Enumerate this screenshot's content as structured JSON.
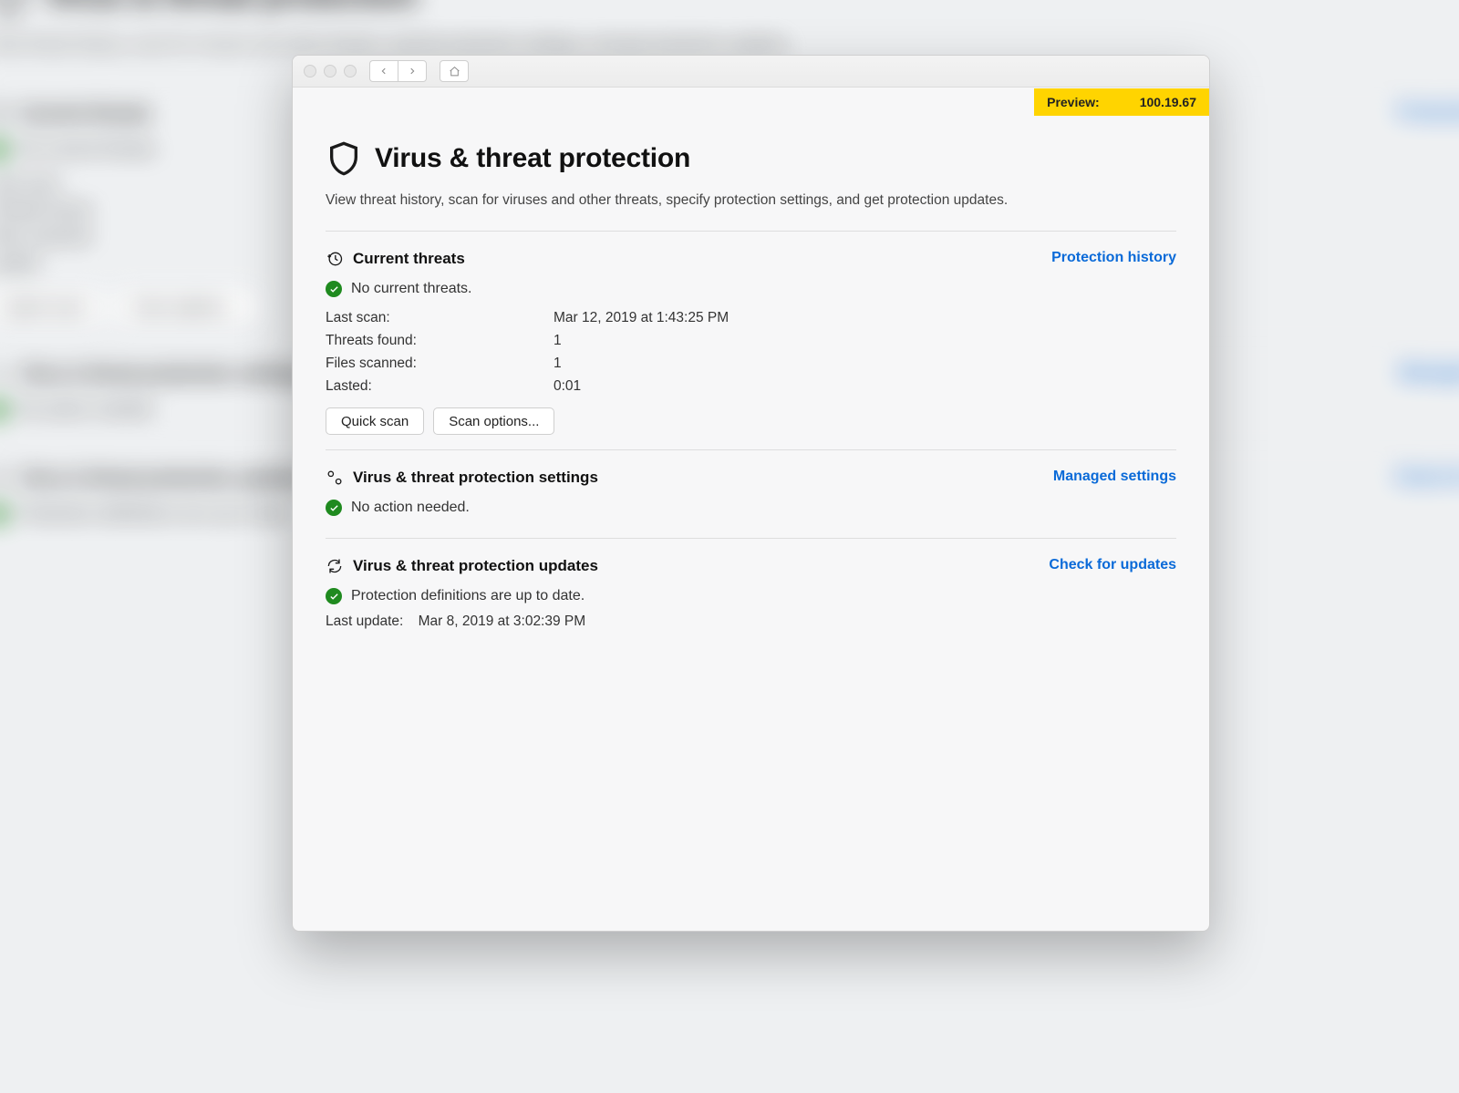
{
  "banner": {
    "label": "Preview:",
    "version": "100.19.67"
  },
  "page": {
    "title": "Virus & threat protection",
    "subtitle": "View threat history, scan for viruses and other threats, specify protection settings, and get protection updates."
  },
  "threats": {
    "heading": "Current threats",
    "link": "Protection history",
    "status": "No current threats.",
    "kv": {
      "last_scan_label": "Last scan:",
      "last_scan_value": "Mar 12, 2019 at 1:43:25 PM",
      "threats_found_label": "Threats found:",
      "threats_found_value": "1",
      "files_scanned_label": "Files scanned:",
      "files_scanned_value": "1",
      "lasted_label": "Lasted:",
      "lasted_value": "0:01"
    },
    "quick_scan": "Quick scan",
    "scan_options": "Scan options..."
  },
  "settings": {
    "heading": "Virus & threat protection settings",
    "link": "Managed settings",
    "status": "No action needed."
  },
  "updates": {
    "heading": "Virus & threat protection updates",
    "link": "Check for updates",
    "status": "Protection definitions are up to date.",
    "last_update_label": "Last update:",
    "last_update_value": "Mar 8, 2019 at 3:02:39 PM"
  }
}
